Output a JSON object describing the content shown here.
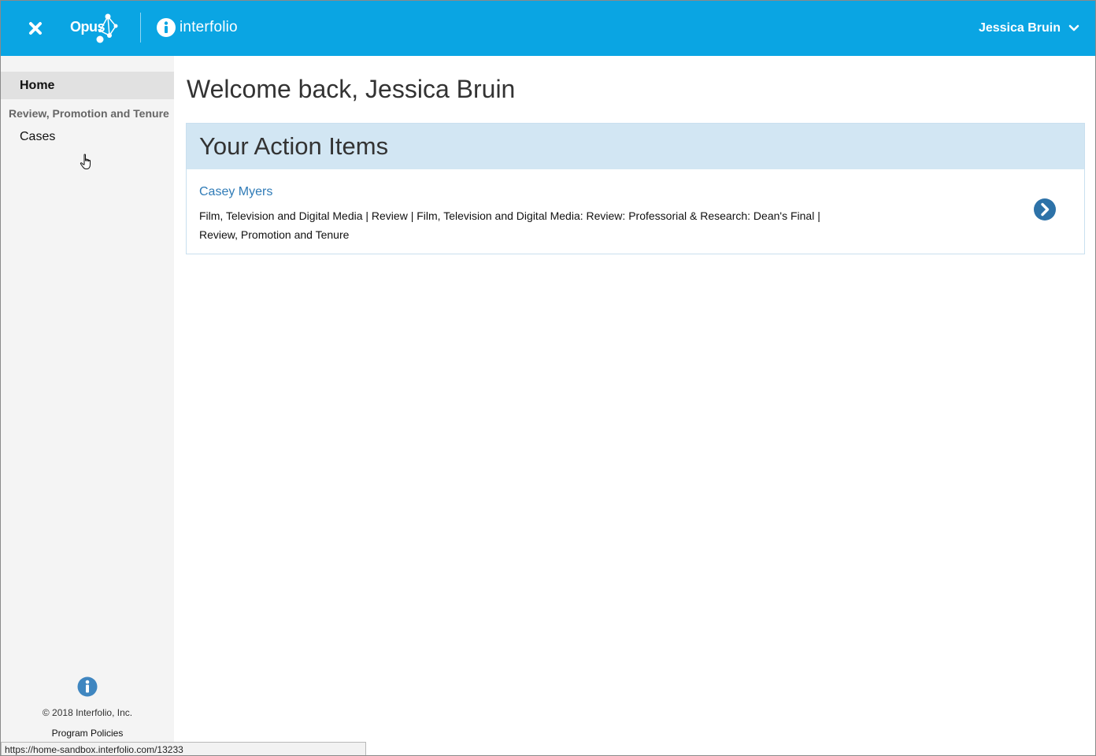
{
  "header": {
    "app_name": "Opus",
    "brand_name": "interfolio",
    "user_name": "Jessica Bruin",
    "colors": {
      "bar": "#0aa5e3",
      "text": "#ffffff"
    },
    "icons": [
      "close-icon",
      "opus-constellation-icon",
      "interfolio-i-icon",
      "chevron-down-icon"
    ]
  },
  "sidebar": {
    "home_label": "Home",
    "section_label": "Review, Promotion and Tenure",
    "cases_label": "Cases",
    "footer": {
      "copyright": "© 2018 Interfolio, Inc.",
      "policies_label": "Program Policies"
    }
  },
  "main": {
    "welcome": "Welcome back, Jessica Bruin",
    "action_items": {
      "title": "Your Action Items",
      "items": [
        {
          "name": "Casey Myers",
          "description": "Film, Television and Digital Media | Review | Film, Television and Digital Media: Review: Professorial & Research: Dean's Final | Review, Promotion and Tenure"
        }
      ]
    }
  },
  "status_bar": {
    "url": "https://home-sandbox.interfolio.com/13233"
  }
}
